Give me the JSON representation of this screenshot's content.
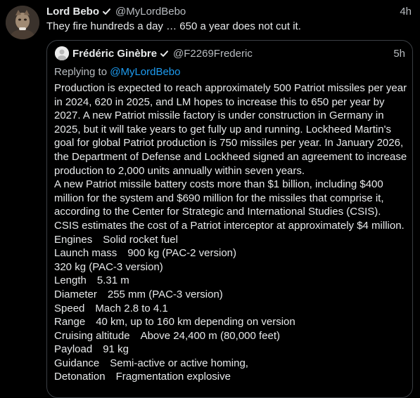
{
  "tweet": {
    "author_name": "Lord Bebo",
    "author_handle": "@MyLordBebo",
    "time": "4h",
    "text": "They fire hundreds a day … 650 a year does not cut it."
  },
  "quoted": {
    "author_name": "Frédéric Ginèbre",
    "author_handle": "@F2269Frederic",
    "time": "5h",
    "replying_prefix": "Replying to",
    "replying_handle": "@MyLordBebo",
    "paragraphs": [
      "Production is expected to reach approximately 500 Patriot missiles per year in 2024, 620 in 2025, and LM hopes to increase this to 650 per year by 2027. A new Patriot missile factory is under construction in Germany in 2025, but it will take years to get fully up and running. Lockheed Martin's goal for global Patriot production is 750 missiles per year. In January 2026, the Department of Defense and Lockheed signed an agreement to increase production to 2,000 units annually within seven years.",
      "A new Patriot missile battery costs more than $1 billion, including $400 million for the system and $690 million for the missiles that comprise it, according to the Center for Strategic and International Studies (CSIS).",
      "CSIS estimates the cost of a Patriot interceptor at approximately $4 million."
    ],
    "specs": [
      {
        "label": "Engines",
        "value": "Solid rocket fuel"
      },
      {
        "label": "Launch mass",
        "value": "900 kg (PAC-2 version)"
      },
      {
        "label": "",
        "value": "320 kg (PAC-3 version)"
      },
      {
        "label": "Length",
        "value": "5.31 m"
      },
      {
        "label": "Diameter",
        "value": "255 mm (PAC-3 version)"
      },
      {
        "label": "Speed",
        "value": "Mach 2.8 to 4.1"
      },
      {
        "label": "Range",
        "value": "40 km, up to 160 km depending on version"
      },
      {
        "label": "Cruising altitude",
        "value": "Above 24,400 m (80,000 feet)"
      },
      {
        "label": "Payload",
        "value": "91 kg"
      },
      {
        "label": "Guidance",
        "value": "Semi-active or active homing,"
      },
      {
        "label": "Detonation",
        "value": "Fragmentation explosive"
      }
    ]
  },
  "icons": {
    "verified": "verified-check-icon"
  },
  "colors": {
    "background": "#000000",
    "text": "#e7e9ea",
    "muted": "#b8bcc0",
    "link": "#1d9bf0",
    "border": "#3b3f44"
  }
}
